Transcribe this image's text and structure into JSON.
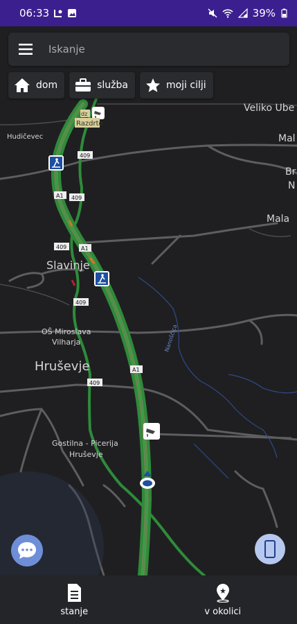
{
  "status_bar": {
    "time": "06:33",
    "battery": "39%"
  },
  "search": {
    "placeholder": "Iskanje"
  },
  "shortcuts": [
    {
      "label": "dom",
      "icon": "home-icon"
    },
    {
      "label": "služba",
      "icon": "briefcase-icon"
    },
    {
      "label": "moji cilji",
      "icon": "star-icon"
    }
  ],
  "map": {
    "places": {
      "veliko_ube": "Veliko Ube",
      "mal": "Mal",
      "br": "Br",
      "n": "N",
      "mala": "Mala",
      "hudicevec": "Hudičevec",
      "slavinje": "Slavinje",
      "os": "OŠ Miroslava",
      "os2": "Vilharja",
      "hrusevje": "Hruševje",
      "gostilna": "Gostilna - Picerija",
      "gostilna2": "Hruševje",
      "nanoscica": "Nanoščica",
      "razdrto1": "Razdrto",
      "razdrto_top": "dz"
    },
    "road_labels": {
      "r409a": "409",
      "r409b": "409",
      "r409c": "409",
      "r409d": "409",
      "r409e": "409",
      "a1a": "A1",
      "a1b": "A1",
      "a1c": "A1"
    }
  },
  "bottom_nav": [
    {
      "label": "stanje",
      "icon": "document-icon"
    },
    {
      "label": "v okolici",
      "icon": "location-pin-icon"
    }
  ]
}
